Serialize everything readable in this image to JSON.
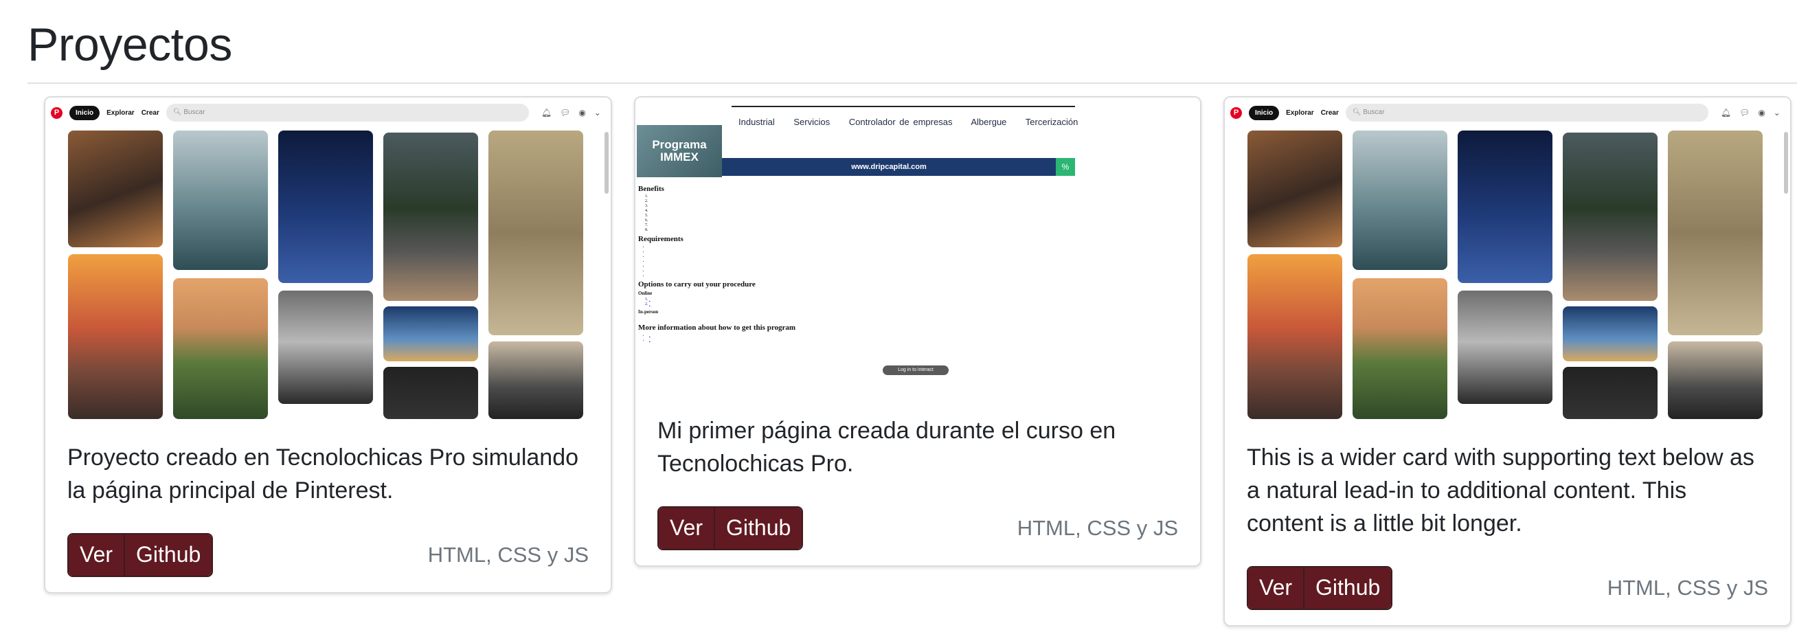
{
  "page": {
    "title": "Proyectos"
  },
  "cards": [
    {
      "description": "Proyecto creado en Tecnolochicas Pro simulando la página principal de Pinterest.",
      "view_label": "Ver",
      "github_label": "Github",
      "tech": "HTML, CSS y JS",
      "screenshot": {
        "kind": "pinterest",
        "nav": {
          "home": "Inicio",
          "explore": "Explorar",
          "create": "Crear",
          "search_placeholder": "Buscar"
        }
      }
    },
    {
      "description": "Mi primer página creada durante el curso en Tecnolochicas Pro.",
      "view_label": "Ver",
      "github_label": "Github",
      "tech": "HTML, CSS y JS",
      "screenshot": {
        "kind": "immex",
        "nav": [
          "Industrial",
          "Servicios",
          "Controlador de empresas",
          "Albergue",
          "Tercerización"
        ],
        "banner": "Programa IMMEX",
        "bar_text": "www.dripcapital.com",
        "headings": [
          "Benefits",
          "Requirements",
          "Options to carry out your procedure",
          "Online",
          "In-person",
          "More information about how to get this program"
        ],
        "pill": "Log in to interact"
      }
    },
    {
      "description": "This is a wider card with supporting text below as a natural lead-in to additional content. This content is a little bit longer.",
      "view_label": "Ver",
      "github_label": "Github",
      "tech": "HTML, CSS y JS",
      "screenshot": {
        "kind": "pinterest",
        "nav": {
          "home": "Inicio",
          "explore": "Explorar",
          "create": "Crear",
          "search_placeholder": "Buscar"
        }
      }
    }
  ]
}
